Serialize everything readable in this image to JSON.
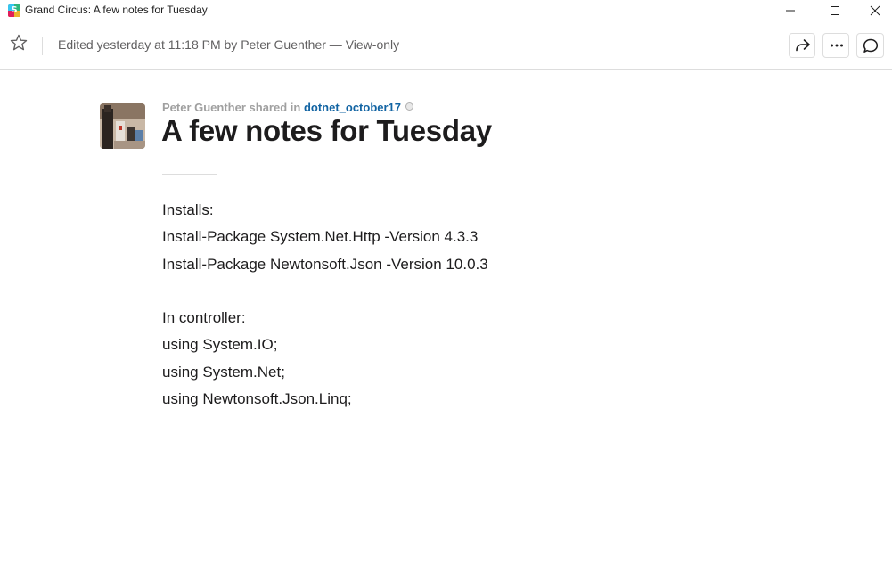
{
  "window": {
    "title": "Grand Circus: A few notes for Tuesday",
    "app_icon_glyph": "S"
  },
  "header": {
    "edited_text": "Edited yesterday at 11:18 PM by Peter Guenther — View-only"
  },
  "post": {
    "shared_prefix": "Peter Guenther shared in ",
    "channel": "dotnet_october17",
    "title": "A few notes for Tuesday",
    "lines": [
      "Installs:",
      "Install-Package System.Net.Http -Version 4.3.3",
      "Install-Package Newtonsoft.Json -Version 10.0.3",
      "",
      "In controller:",
      "using System.IO;",
      "using System.Net;",
      "using Newtonsoft.Json.Linq;"
    ]
  },
  "icons": {
    "star": "star-outline-icon",
    "share": "share-arrow-icon",
    "more": "more-horizontal-icon",
    "thread": "comment-bubble-icon"
  },
  "colors": {
    "link": "#1264a3",
    "text": "#1d1c1d",
    "muted": "#616061",
    "shared_label": "#a0a0a0"
  }
}
